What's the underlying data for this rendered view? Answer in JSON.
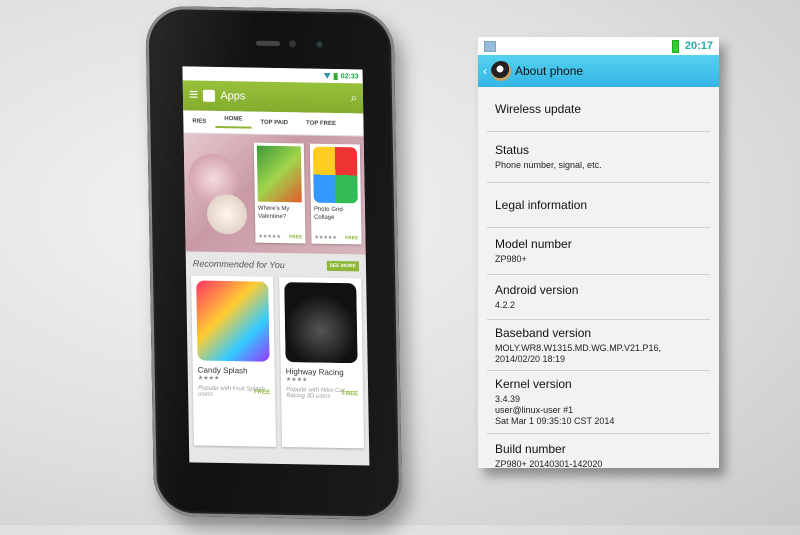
{
  "playstore": {
    "status_time": "02:33",
    "app_title": "Apps",
    "tabs": [
      "RIES",
      "HOME",
      "TOP PAID",
      "TOP FREE"
    ],
    "featured": [
      {
        "name": "Where's My Valentine?",
        "badge": "Free",
        "price": "FREE",
        "stars": "★★★★★"
      },
      {
        "name": "Photo Grid- Collage",
        "price": "FREE",
        "stars": "★★★★★"
      }
    ],
    "recommended_title": "Recommended for You",
    "see_more": "SEE MORE",
    "recommended": [
      {
        "name": "Candy Splash",
        "stars": "★★★★",
        "price": "FREE",
        "desc": "Popular with Fruit Splash users"
      },
      {
        "name": "Highway Racing",
        "stars": "★★★★",
        "price": "FREE",
        "desc": "Popular with Nitro Car Racing 3D users"
      }
    ]
  },
  "about": {
    "status_time": "20:17",
    "title": "About phone",
    "items": [
      {
        "title": "Wireless update"
      },
      {
        "title": "Status",
        "subtitle": "Phone number, signal, etc."
      },
      {
        "title": "Legal information"
      },
      {
        "title": "Model number",
        "subtitle": "ZP980+"
      },
      {
        "title": "Android version",
        "subtitle": "4.2.2"
      },
      {
        "title": "Baseband version",
        "subtitle": "MOLY.WR8.W1315.MD.WG.MP.V21.P16, 2014/02/20 18:19"
      },
      {
        "title": "Kernel version",
        "subtitle": "3.4.39\nuser@linux-user #1\nSat Mar 1 09:35:10 CST 2014"
      },
      {
        "title": "Build number",
        "subtitle": "ZP980+ 20140301-142020"
      }
    ]
  }
}
